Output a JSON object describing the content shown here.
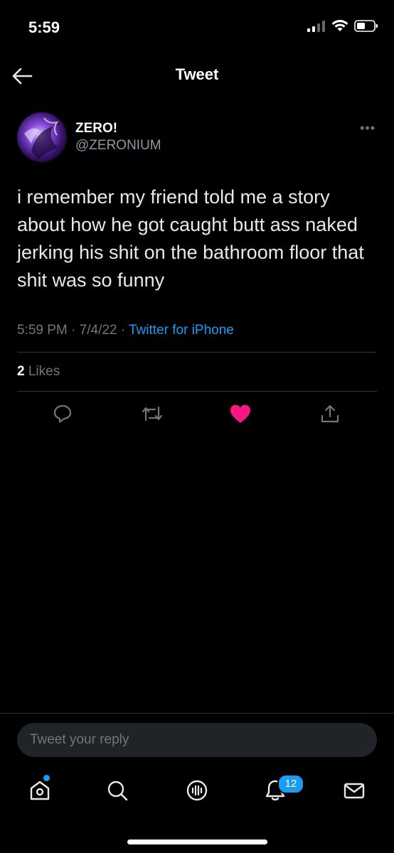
{
  "status_bar": {
    "time": "5:59"
  },
  "header": {
    "title": "Tweet"
  },
  "tweet": {
    "author_name": "ZERO!",
    "author_handle": "@ZERONIUM",
    "text": "i remember my friend told me a story about how he got caught butt ass naked jerking his shit on the bathroom floor that shit was so funny",
    "time": "5:59 PM",
    "date": "7/4/22",
    "source": "Twitter for iPhone",
    "likes_count": "2",
    "likes_label": "Likes",
    "liked": true
  },
  "reply": {
    "placeholder": "Tweet your reply"
  },
  "tab_bar": {
    "notifications_count": "12"
  },
  "colors": {
    "accent": "#1d9bf0",
    "like": "#f91880",
    "background": "#000000",
    "muted": "#71767b"
  }
}
